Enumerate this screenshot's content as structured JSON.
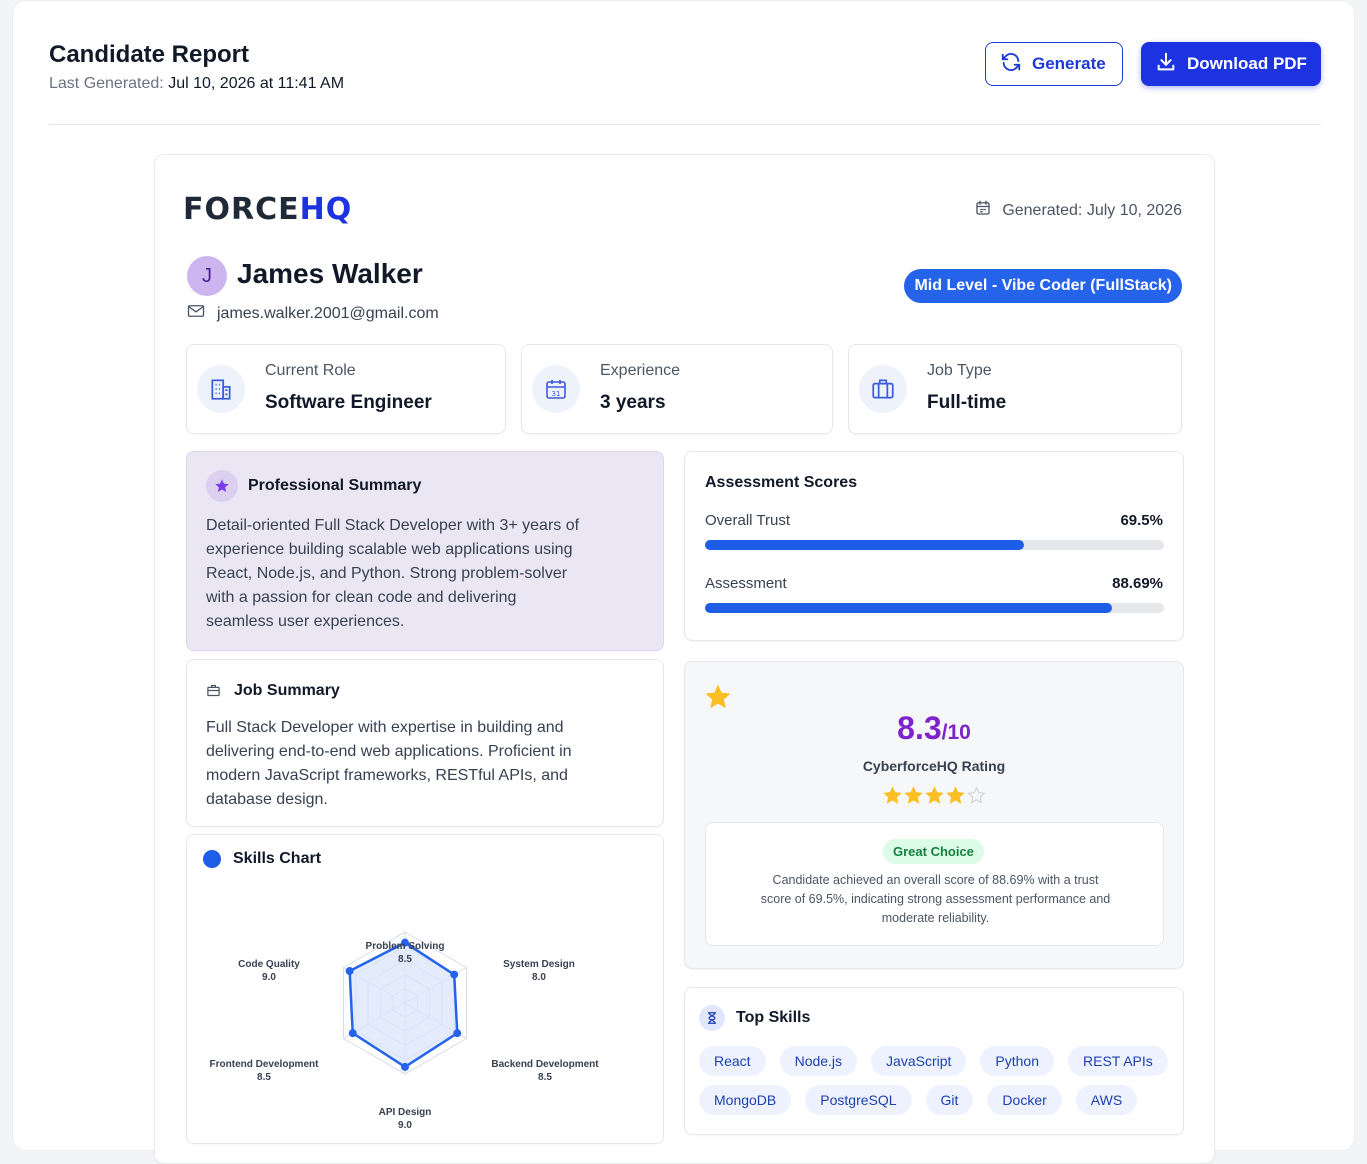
{
  "header": {
    "title": "Candidate Report",
    "last_generated_label": "Last Generated:",
    "last_generated_value": "Jul 10, 2026 at 11:41 AM",
    "generate_label": "Generate",
    "download_label": "Download PDF"
  },
  "report": {
    "logo_part1": "FORCE",
    "logo_part2": "HQ",
    "generated_text": "Generated: July 10, 2026",
    "avatar_initial": "J",
    "name": "James Walker",
    "email": "james.walker.2001@gmail.com",
    "level_badge": "Mid Level - Vibe Coder (FullStack)"
  },
  "info_cards": [
    {
      "label": "Current Role",
      "value": "Software Engineer",
      "icon": "building-icon"
    },
    {
      "label": "Experience",
      "value": "3 years",
      "icon": "calendar-icon"
    },
    {
      "label": "Job Type",
      "value": "Full-time",
      "icon": "briefcase-icon"
    }
  ],
  "professional_summary": {
    "title": "Professional Summary",
    "lines": [
      "Detail-oriented Full Stack Developer with 3+ years of",
      "experience building scalable web applications using",
      "React, Node.js, and Python. Strong problem-solver",
      "with a passion for clean code and delivering",
      "seamless user experiences."
    ]
  },
  "job_summary": {
    "title": "Job Summary",
    "lines": [
      "Full Stack Developer with expertise in building and",
      "delivering end-to-end web applications. Proficient in",
      "modern JavaScript frameworks, RESTful APIs, and",
      "database design."
    ]
  },
  "assessment_scores": {
    "title": "Assessment Scores",
    "items": [
      {
        "label": "Overall Trust",
        "value_text": "69.5%",
        "percent": 69.5
      },
      {
        "label": "Assessment",
        "value_text": "88.69%",
        "percent": 88.69
      }
    ]
  },
  "rating": {
    "score": "8.3",
    "scale": "/10",
    "label": "CyberforceHQ Rating",
    "stars_filled": 4,
    "stars_total": 5,
    "verdict": "Great Choice",
    "verdict_lines": [
      "Candidate achieved an overall score of 88.69% with a trust",
      "score of 69.5%, indicating strong assessment performance and",
      "moderate reliability."
    ]
  },
  "top_skills": {
    "title": "Top Skills",
    "items": [
      "React",
      "Node.js",
      "JavaScript",
      "Python",
      "REST APIs",
      "MongoDB",
      "PostgreSQL",
      "Git",
      "Docker",
      "AWS"
    ]
  },
  "skills_chart": {
    "title": "Skills Chart"
  },
  "chart_data": {
    "type": "radar",
    "categories": [
      "Problem Solving",
      "System Design",
      "Backend Development",
      "API Design",
      "Frontend Development",
      "Code Quality"
    ],
    "values": [
      8.5,
      8.0,
      8.5,
      9.0,
      8.5,
      9.0
    ],
    "value_labels": [
      "8.5",
      "8.0",
      "8.5",
      "9.0",
      "8.5",
      "9.0"
    ],
    "range": [
      0,
      10
    ],
    "color": "#2563eb",
    "fill": "#dbe6fb"
  },
  "colors": {
    "primary": "#1d32e0",
    "badge": "#2563eb",
    "rating": "#7e22ce",
    "star": "#fbbf24",
    "verdict_bg": "#dcfce7",
    "verdict_text": "#15803d"
  }
}
